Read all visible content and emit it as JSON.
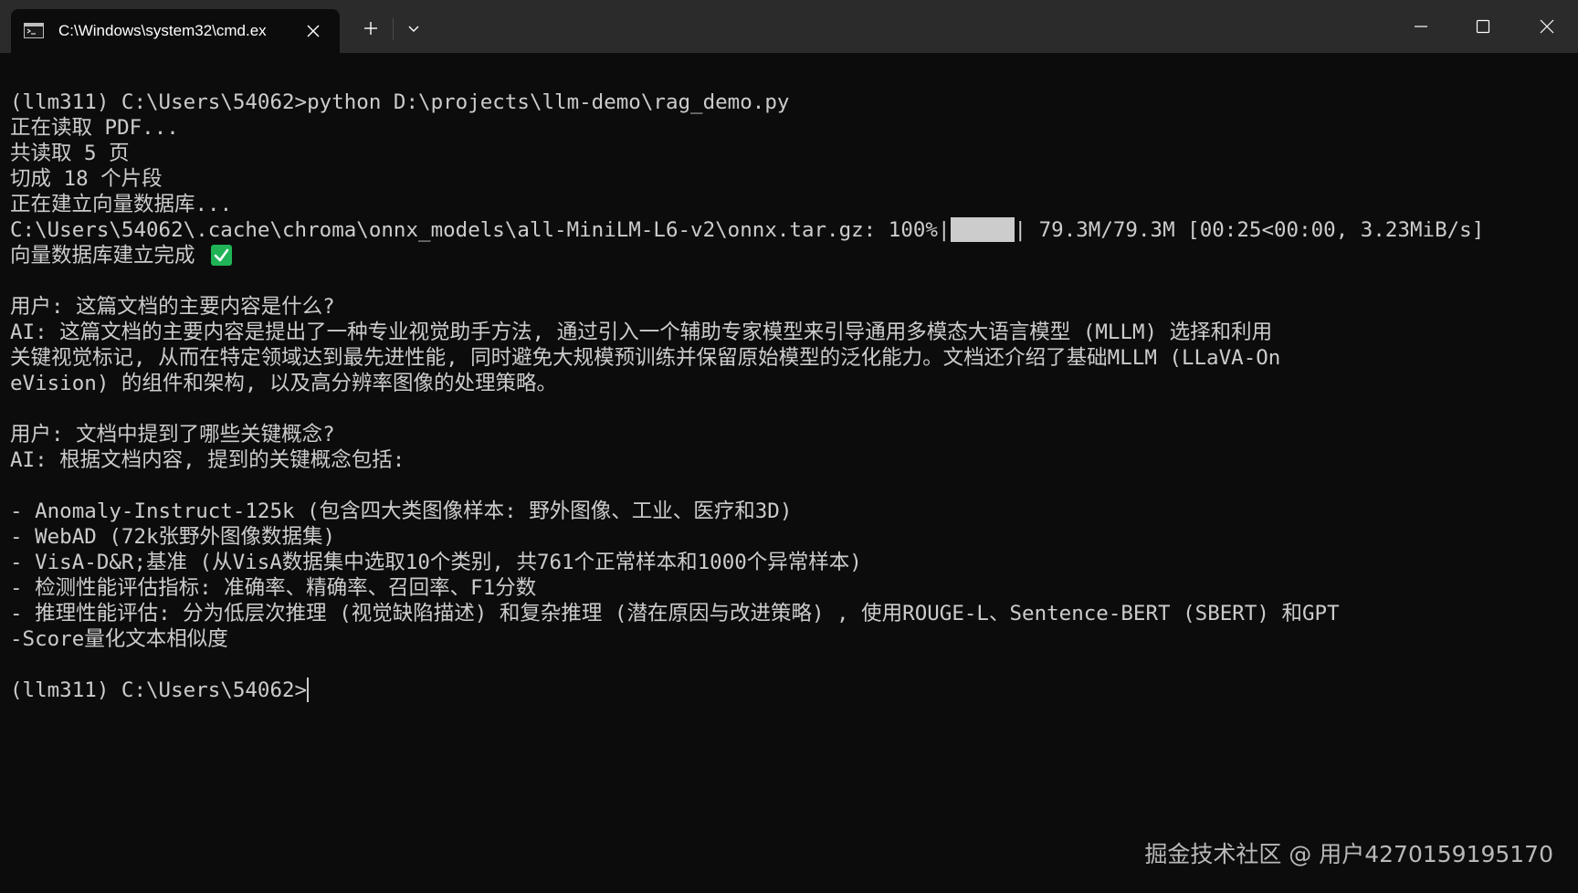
{
  "window": {
    "tab_title": "C:\\Windows\\system32\\cmd.ex",
    "icons": {
      "tab": "terminal-icon",
      "close_tab": "close-icon",
      "new_tab": "plus-icon",
      "dropdown": "chevron-down-icon",
      "minimize": "minimize-icon",
      "maximize": "maximize-icon",
      "close_window": "close-icon"
    },
    "colors": {
      "background": "#0c0c0c",
      "titlebar": "#2b2b2b",
      "text": "#cccccc",
      "check": "#20b456"
    }
  },
  "terminal": {
    "lines": [
      "(llm311) C:\\Users\\54062>python D:\\projects\\llm-demo\\rag_demo.py",
      "正在读取 PDF...",
      "共读取 5 页",
      "切成 18 个片段",
      "正在建立向量数据库...",
      "",
      "向量数据库建立完成",
      "",
      "用户: 这篇文档的主要内容是什么?",
      "AI: 这篇文档的主要内容是提出了一种专业视觉助手方法, 通过引入一个辅助专家模型来引导通用多模态大语言模型 (MLLM) 选择和利用",
      "关键视觉标记, 从而在特定领域达到最先进性能, 同时避免大规模预训练并保留原始模型的泛化能力。文档还介绍了基础MLLM (LLaVA-On",
      "eVision) 的组件和架构, 以及高分辨率图像的处理策略。",
      "",
      "用户: 文档中提到了哪些关键概念?",
      "AI: 根据文档内容, 提到的关键概念包括:",
      "",
      "- Anomaly-Instruct-125k (包含四大类图像样本: 野外图像、工业、医疗和3D)",
      "- WebAD (72k张野外图像数据集)",
      "- VisA-D&R;基准 (从VisA数据集中选取10个类别, 共761个正常样本和1000个异常样本)",
      "- 检测性能评估指标: 准确率、精确率、召回率、F1分数",
      "- 推理性能评估: 分为低层次推理 (视觉缺陷描述) 和复杂推理 (潜在原因与改进策略) , 使用ROUGE-L、Sentence-BERT (SBERT) 和GPT",
      "-Score量化文本相似度",
      "",
      "(llm311) C:\\Users\\54062>"
    ],
    "progress": {
      "prefix": "C:\\Users\\54062\\.cache\\chroma\\onnx_models\\all-MiniLM-L6-v2\\onnx.tar.gz: 100%|",
      "suffix": "| 79.3M/79.3M [00:25<00:00, 3.23MiB/s]",
      "percent": 100
    }
  },
  "watermark": "掘金技术社区 @ 用户4270159195170"
}
